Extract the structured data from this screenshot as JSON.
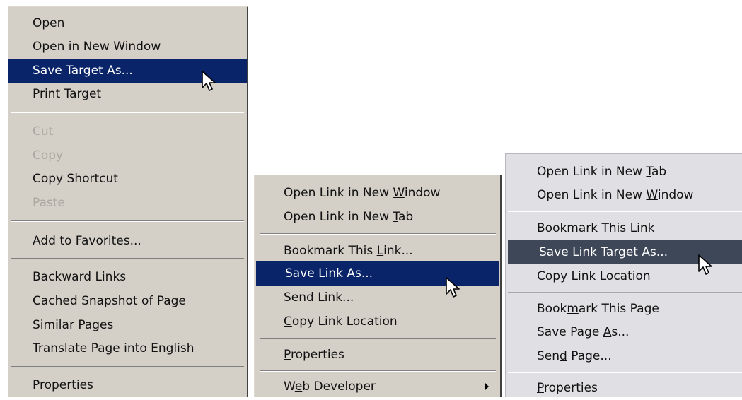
{
  "menu_ie": {
    "items": [
      {
        "label": "Open",
        "state": "normal"
      },
      {
        "label": "Open in New Window",
        "state": "normal"
      },
      {
        "label": "Save Target As...",
        "state": "selected"
      },
      {
        "label": "Print Target",
        "state": "normal"
      },
      {
        "label": "Cut",
        "state": "disabled"
      },
      {
        "label": "Copy",
        "state": "disabled"
      },
      {
        "label": "Copy Shortcut",
        "state": "normal"
      },
      {
        "label": "Paste",
        "state": "disabled"
      },
      {
        "label": "Add to Favorites...",
        "state": "normal"
      },
      {
        "label": "Backward Links",
        "state": "normal"
      },
      {
        "label": "Cached Snapshot of Page",
        "state": "normal"
      },
      {
        "label": "Similar Pages",
        "state": "normal"
      },
      {
        "label": "Translate Page into English",
        "state": "normal"
      },
      {
        "label": "Properties",
        "state": "normal"
      }
    ]
  },
  "menu_firefox_xp": {
    "items": [
      {
        "label": "Open Link in New Window",
        "mnemonic": "W",
        "state": "normal"
      },
      {
        "label": "Open Link in New Tab",
        "mnemonic": "T",
        "state": "normal"
      },
      {
        "label": "Bookmark This Link...",
        "mnemonic": "L",
        "state": "normal"
      },
      {
        "label": "Save Link As...",
        "mnemonic": "k",
        "state": "selected"
      },
      {
        "label": "Send Link...",
        "mnemonic": "d",
        "state": "normal"
      },
      {
        "label": "Copy Link Location",
        "mnemonic": "C",
        "state": "normal"
      },
      {
        "label": "Properties",
        "mnemonic": "P",
        "state": "normal"
      },
      {
        "label": "Web Developer",
        "mnemonic": "e",
        "state": "normal",
        "submenu": true
      }
    ]
  },
  "menu_firefox_theme": {
    "items": [
      {
        "label": "Open Link in New Tab",
        "mnemonic": "T",
        "state": "normal"
      },
      {
        "label": "Open Link in New Window",
        "mnemonic": "W",
        "state": "normal"
      },
      {
        "label": "Bookmark This Link",
        "mnemonic": "L",
        "state": "normal"
      },
      {
        "label": "Save Link Target As...",
        "mnemonic": "r",
        "state": "selected"
      },
      {
        "label": "Copy Link Location",
        "mnemonic": "C",
        "state": "normal"
      },
      {
        "label": "Bookmark This Page",
        "mnemonic": "m",
        "state": "normal"
      },
      {
        "label": "Save Page As...",
        "mnemonic": "A",
        "state": "normal"
      },
      {
        "label": "Send Page...",
        "mnemonic": "d",
        "state": "normal"
      },
      {
        "label": "Properties",
        "mnemonic": "P",
        "state": "normal"
      }
    ]
  },
  "colors": {
    "menu_face_classic": "#d4d0c8",
    "selection_navy": "#0a246a",
    "menu_face_light": "#e0dfe3",
    "selection_slate": "#3e4758",
    "disabled_text": "#a9a79f"
  }
}
